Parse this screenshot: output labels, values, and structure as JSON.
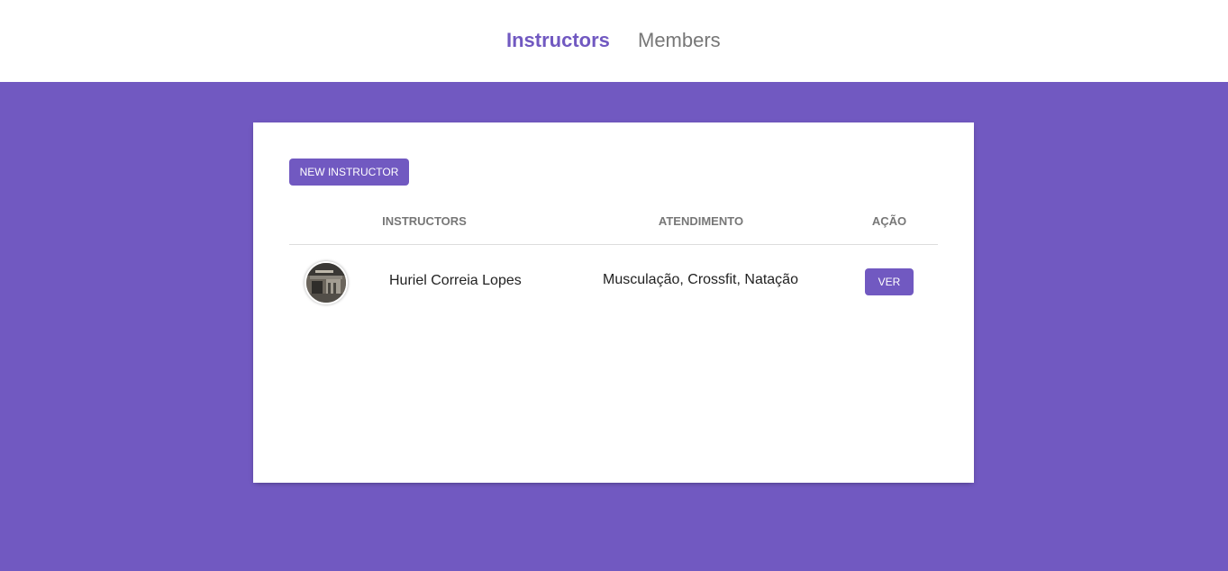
{
  "nav": {
    "instructors_label": "Instructors",
    "members_label": "Members"
  },
  "toolbar": {
    "new_instructor_label": "NEW INSTRUCTOR"
  },
  "table": {
    "columns": [
      "INSTRUCTORS",
      "ATENDIMENTO",
      "AÇÃO"
    ],
    "rows": [
      {
        "avatar": "instructor-photo",
        "name": "Huriel Correia Lopes",
        "services": "Musculação, Crossfit, Natação",
        "action_label": "VER"
      }
    ]
  },
  "colors": {
    "accent": "#7159c1",
    "header_bg": "#ffffff",
    "nav_inactive": "#777777",
    "card_bg": "#ffffff",
    "text": "#222222"
  }
}
